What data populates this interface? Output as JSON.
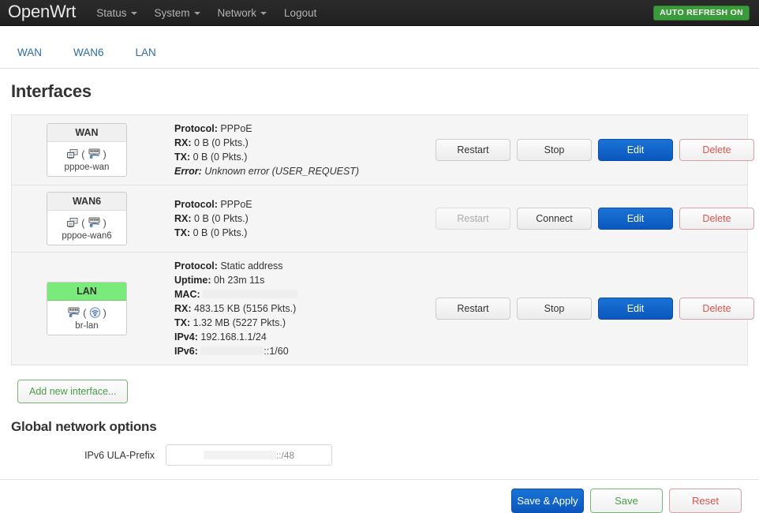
{
  "header": {
    "brand": "OpenWrt",
    "nav": [
      {
        "label": "Status",
        "has_caret": true
      },
      {
        "label": "System",
        "has_caret": true
      },
      {
        "label": "Network",
        "has_caret": true
      },
      {
        "label": "Logout",
        "has_caret": false
      }
    ],
    "auto_refresh_badge": "AUTO REFRESH ON",
    "auto_refresh_color": "#3a9b3a"
  },
  "tabs": [
    {
      "label": "WAN"
    },
    {
      "label": "WAN6"
    },
    {
      "label": "LAN"
    }
  ],
  "page_title": "Interfaces",
  "interfaces": [
    {
      "name": "WAN",
      "device": "pppoe-wan",
      "state": "down",
      "icons": [
        "network-computers-icon",
        "ethernet-port-icon"
      ],
      "details": [
        {
          "key": "Protocol:",
          "value": "PPPoE",
          "style": "normal"
        },
        {
          "key": "RX:",
          "value": "0 B (0 Pkts.)",
          "style": "normal"
        },
        {
          "key": "TX:",
          "value": "0 B (0 Pkts.)",
          "style": "normal"
        },
        {
          "key": "Error:",
          "value": "Unknown error (USER_REQUEST)",
          "style": "italic"
        }
      ],
      "buttons": [
        {
          "label": "Restart",
          "variant": "default",
          "disabled": false
        },
        {
          "label": "Stop",
          "variant": "default",
          "disabled": false
        },
        {
          "label": "Edit",
          "variant": "primary",
          "disabled": false
        },
        {
          "label": "Delete",
          "variant": "danger",
          "disabled": false
        }
      ]
    },
    {
      "name": "WAN6",
      "device": "pppoe-wan6",
      "state": "down",
      "icons": [
        "network-computers-icon",
        "ethernet-port-icon"
      ],
      "details": [
        {
          "key": "Protocol:",
          "value": "PPPoE",
          "style": "normal"
        },
        {
          "key": "RX:",
          "value": "0 B (0 Pkts.)",
          "style": "normal"
        },
        {
          "key": "TX:",
          "value": "0 B (0 Pkts.)",
          "style": "normal"
        }
      ],
      "buttons": [
        {
          "label": "Restart",
          "variant": "default",
          "disabled": true
        },
        {
          "label": "Connect",
          "variant": "default",
          "disabled": false
        },
        {
          "label": "Edit",
          "variant": "primary",
          "disabled": false
        },
        {
          "label": "Delete",
          "variant": "danger",
          "disabled": false
        }
      ]
    },
    {
      "name": "LAN",
      "device": "br-lan",
      "state": "up",
      "icons": [
        "ethernet-port-icon",
        "wifi-icon"
      ],
      "details": [
        {
          "key": "Protocol:",
          "value": "Static address",
          "style": "normal"
        },
        {
          "key": "Uptime:",
          "value": "0h 23m 11s",
          "style": "normal"
        },
        {
          "key": "MAC:",
          "value": "",
          "style": "redacted",
          "redact_width": 120
        },
        {
          "key": "RX:",
          "value": "483.15 KB (5156 Pkts.)",
          "style": "normal"
        },
        {
          "key": "TX:",
          "value": "1.32 MB (5227 Pkts.)",
          "style": "normal"
        },
        {
          "key": "IPv4:",
          "value": "192.168.1.1/24",
          "style": "normal"
        },
        {
          "key": "IPv6:",
          "value": "::1/60",
          "style": "redacted-prefix",
          "redact_width": 80
        }
      ],
      "buttons": [
        {
          "label": "Restart",
          "variant": "default",
          "disabled": false
        },
        {
          "label": "Stop",
          "variant": "default",
          "disabled": false
        },
        {
          "label": "Edit",
          "variant": "primary",
          "disabled": false
        },
        {
          "label": "Delete",
          "variant": "danger",
          "disabled": false
        }
      ]
    }
  ],
  "add_interface_button": "Add new interface...",
  "global_options": {
    "title": "Global network options",
    "ula_label": "IPv6 ULA-Prefix",
    "ula_value_suffix": "::/48"
  },
  "footer_buttons": [
    {
      "label": "Save & Apply",
      "variant": "primary"
    },
    {
      "label": "Save",
      "variant": "success"
    },
    {
      "label": "Reset",
      "variant": "danger"
    }
  ],
  "colors": {
    "accent_blue": "#0b57bf",
    "link_blue": "#2e6da4",
    "danger_red": "#d9534f",
    "success_green": "#4a9c4a",
    "badge_up_green": "#7aea7a"
  }
}
